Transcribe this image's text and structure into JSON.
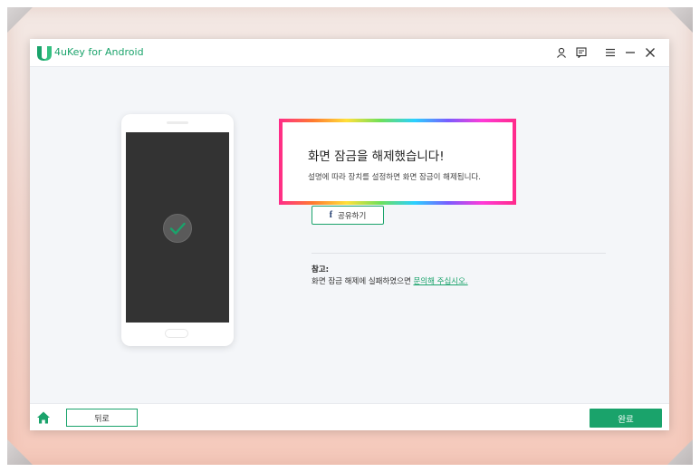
{
  "window": {
    "app_title": "4uKey for Android"
  },
  "titlebar": {
    "icons": [
      "user-icon",
      "feedback-icon",
      "menu-icon",
      "minimize-icon",
      "close-icon"
    ]
  },
  "main": {
    "headline": "화면 잠금을 해제했습니다!",
    "subline": "설명에 따라 장치를 설정하면 화면 잠금이 해제됩니다.",
    "share_label": "공유하기",
    "note_title": "참고:",
    "note_text": "화면 잠금 해제에 실패하였으면 ",
    "note_link": "문의해 주십시오."
  },
  "footer": {
    "back_label": "뒤로",
    "done_label": "완료"
  },
  "colors": {
    "accent": "#1aa36b",
    "screen": "#333333"
  }
}
